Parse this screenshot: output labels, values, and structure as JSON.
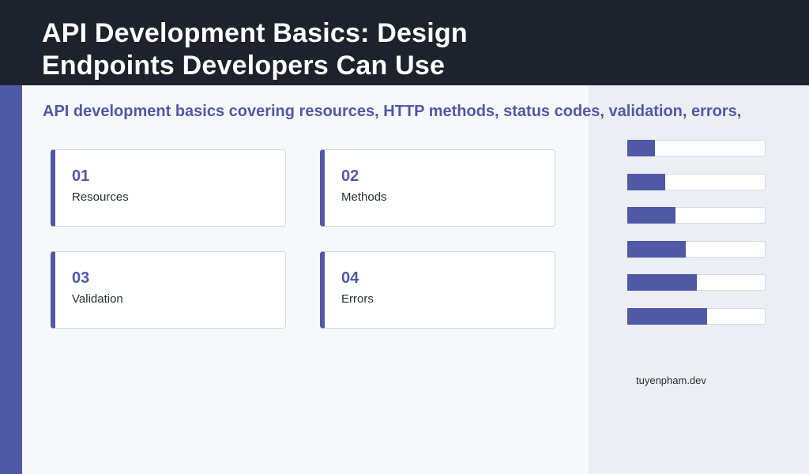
{
  "title": "API Development Basics: Design Endpoints Developers Can Use",
  "subtitle": "API development basics covering resources, HTTP methods, status codes, validation, errors,",
  "cards": [
    {
      "number": "01",
      "label": "Resources"
    },
    {
      "number": "02",
      "label": "Methods"
    },
    {
      "number": "03",
      "label": "Validation"
    },
    {
      "number": "04",
      "label": "Errors"
    }
  ],
  "progress_bars": [
    0.2,
    0.275,
    0.35,
    0.425,
    0.5,
    0.575
  ],
  "footer": "tuyenpham.dev",
  "colors": {
    "accent": "#5059a6",
    "header_bg": "#1e222c",
    "page_bg": "#f6f8fb",
    "side_panel_bg": "#ebeef2"
  }
}
